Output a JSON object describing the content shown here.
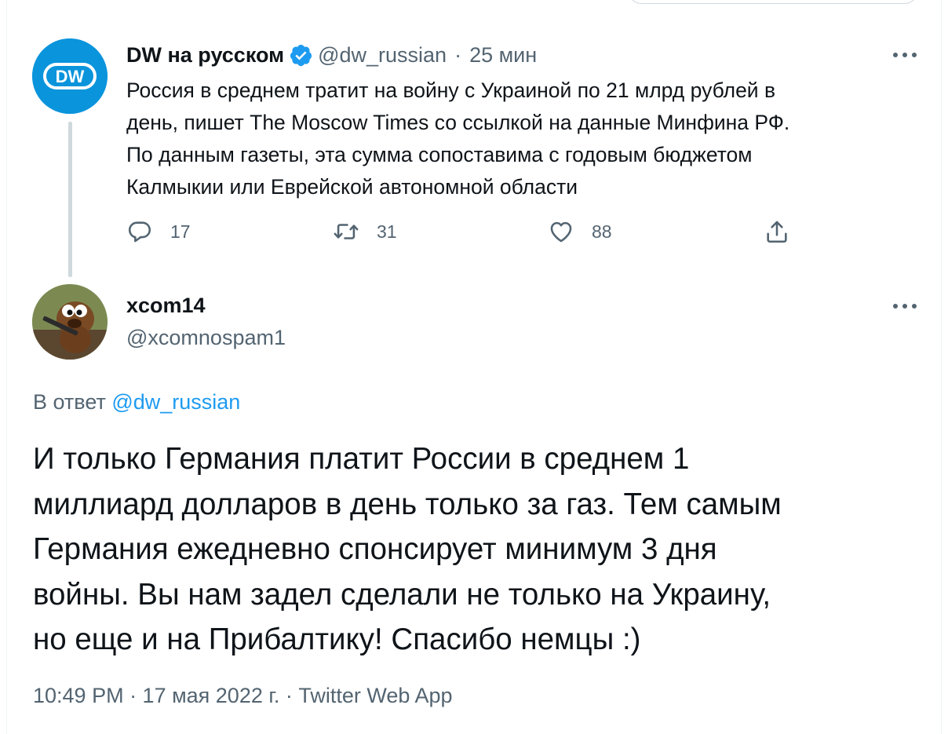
{
  "original_tweet": {
    "author_name": "DW на русском",
    "handle": "@dw_russian",
    "separator": "·",
    "time_ago": "25 мин",
    "avatar_logo_text": "DW",
    "text_lines": [
      "Россия в среднем тратит на войну с Украиной по 21 млрд рублей в",
      "день, пишет The Moscow Times со ссылкой на данные Минфина РФ.",
      "По данным газеты, эта сумма сопоставима с годовым бюджетом",
      "Калмыкии или Еврейской автономной области"
    ],
    "actions": {
      "reply_count": "17",
      "retweet_count": "31",
      "like_count": "88"
    }
  },
  "reply_tweet": {
    "author_name": "xcom14",
    "handle": "@xcomnospam1",
    "reply_to_prefix": "В ответ",
    "reply_to_handle": "@dw_russian",
    "text_lines": [
      "И только Германия платит России в среднем 1",
      "миллиард долларов в день только за газ. Тем самым",
      "Германия ежедневно спонсирует минимум 3 дня",
      "войны. Вы нам задел сделали не только на Украину,",
      "но еще и на Прибалтику! Спасибо немцы :)"
    ],
    "meta": "10:49 PM · 17 мая 2022 г. · Twitter Web App"
  },
  "colors": {
    "text": "#0f1419",
    "muted": "#536471",
    "link": "#1d9bf0",
    "verified": "#1d9bf0",
    "dw_brand": "#0a94dc"
  }
}
